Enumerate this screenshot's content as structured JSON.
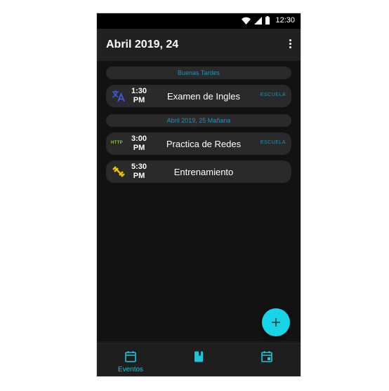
{
  "status_bar": {
    "time": "12:30",
    "icons": [
      "wifi-icon",
      "signal-icon",
      "battery-icon"
    ]
  },
  "app_bar": {
    "title": "Abril 2019, 24",
    "menu_icon": "more-vert-icon"
  },
  "sections": [
    {
      "header": "Buenas Tardes",
      "events": [
        {
          "icon": "translate-icon",
          "time_line1": "1:30",
          "time_line2": "PM",
          "name": "Examen de Ingles",
          "tag": "ESCUELA"
        }
      ]
    },
    {
      "header": "Abril 2019, 25 Mañana",
      "events": [
        {
          "icon": "http-icon",
          "icon_text": "HTTP",
          "time_line1": "3:00",
          "time_line2": "PM",
          "name": "Practica de Redes",
          "tag": "ESCUELA"
        },
        {
          "icon": "fitness-icon",
          "time_line1": "5:30",
          "time_line2": "PM",
          "name": "Entrenamiento",
          "tag": ""
        }
      ]
    }
  ],
  "fab": {
    "icon": "plus-icon"
  },
  "bottom_nav": [
    {
      "icon": "calendar-icon",
      "label": "Eventos",
      "active": true
    },
    {
      "icon": "book-icon",
      "label": "",
      "active": false
    },
    {
      "icon": "event-icon",
      "label": "",
      "active": false
    }
  ],
  "colors": {
    "accent": "#19d3e6",
    "tag_text": "#2f8fb0",
    "background": "#121212",
    "card": "#2a2a2a",
    "translate_icon": "#3b5bdb",
    "http_icon": "#7cd12f",
    "fitness_icon": "#f2c200"
  }
}
